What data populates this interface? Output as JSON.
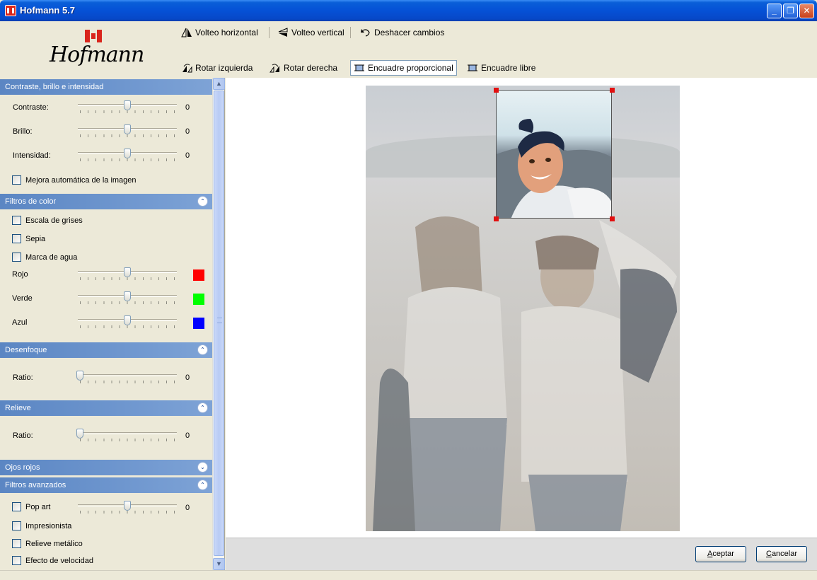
{
  "window": {
    "title": "Hofmann 5.7"
  },
  "logo": {
    "text": "Hofmann"
  },
  "toolbar": {
    "flip_h": "Volteo horizontal",
    "flip_v": "Volteo vertical",
    "undo": "Deshacer cambios",
    "rotate_left": "Rotar izquierda",
    "rotate_right": "Rotar derecha",
    "crop_prop": "Encuadre proporcional",
    "crop_free": "Encuadre libre"
  },
  "sections": {
    "contrast": {
      "title": "Contraste, brillo e intensidad",
      "contraste_label": "Contraste:",
      "contraste_value": "0",
      "brillo_label": "Brillo:",
      "brillo_value": "0",
      "intensidad_label": "Intensidad:",
      "intensidad_value": "0",
      "auto_label": "Mejora automática de la imagen"
    },
    "color": {
      "title": "Filtros de color",
      "grises": "Escala de grises",
      "sepia": "Sepia",
      "agua": "Marca de agua",
      "rojo": "Rojo",
      "verde": "Verde",
      "azul": "Azul",
      "rojo_color": "#ff0000",
      "verde_color": "#00ff00",
      "azul_color": "#0000ff"
    },
    "blur": {
      "title": "Desenfoque",
      "ratio_label": "Ratio:",
      "ratio_value": "0"
    },
    "emboss": {
      "title": "Relieve",
      "ratio_label": "Ratio:",
      "ratio_value": "0"
    },
    "redeye": {
      "title": "Ojos rojos"
    },
    "advanced": {
      "title": "Filtros avanzados",
      "popart": "Pop art",
      "popart_value": "0",
      "impresionista": "Impresionista",
      "metalico": "Relieve metálico",
      "velocidad": "Efecto de velocidad"
    }
  },
  "sliders": {
    "contraste": 0.5,
    "brillo": 0.5,
    "intensidad": 0.5,
    "rojo": 0.5,
    "verde": 0.5,
    "azul": 0.5,
    "blur": 0.0,
    "emboss": 0.0,
    "popart": 0.5
  },
  "buttons": {
    "accept_pre": "",
    "accept_u": "A",
    "accept_post": "ceptar",
    "cancel_u": "C",
    "cancel_post": "ancelar"
  }
}
